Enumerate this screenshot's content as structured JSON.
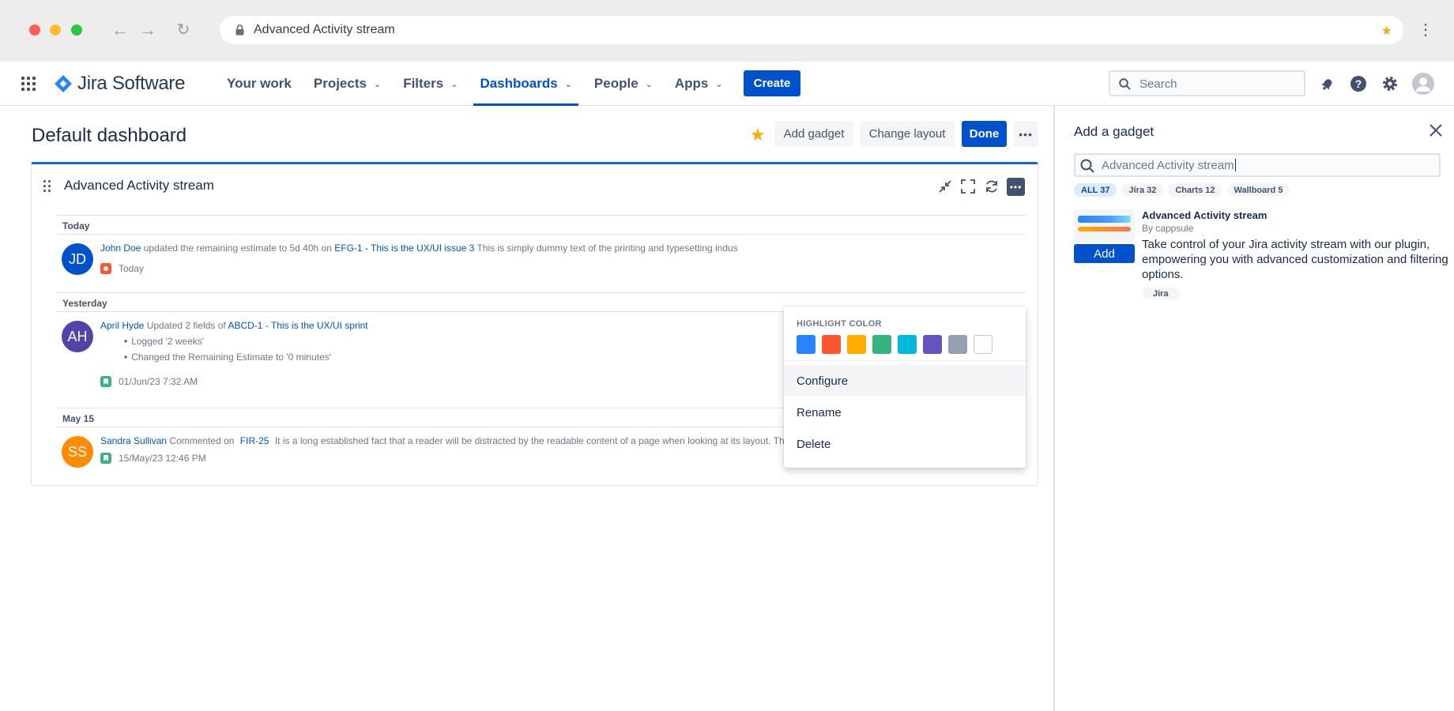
{
  "browser": {
    "url": "Advanced Activity stream"
  },
  "nav": {
    "product": "Jira Software",
    "items": [
      {
        "label": "Your work"
      },
      {
        "label": "Projects"
      },
      {
        "label": "Filters"
      },
      {
        "label": "Dashboards"
      },
      {
        "label": "People"
      },
      {
        "label": "Apps"
      }
    ],
    "active_item": "Dashboards",
    "create_label": "Create",
    "search_placeholder": "Search"
  },
  "dashboard": {
    "title": "Default dashboard",
    "add_gadget_label": "Add gadget",
    "change_layout_label": "Change layout",
    "done_label": "Done"
  },
  "gadget": {
    "title": "Advanced Activity stream",
    "more_label": "•••",
    "groups": [
      {
        "label": "Today",
        "entries": [
          {
            "initials": "JD",
            "avatar_color": "#0052cc",
            "user": "John Doe",
            "action": "updated the remaining estimate to 5d 40h on",
            "issue": "EFG-1 - This is the UX/UI issue 3",
            "extra": "This is simply dummy text of the printing and typesetting indus",
            "time": "Today"
          }
        ]
      },
      {
        "label": "Yesterday",
        "entries": [
          {
            "initials": "AH",
            "avatar_color": "#5243aa",
            "user": "April Hyde",
            "action": "Updated 2 fields of",
            "issue": "ABCD-1 - This is the UX/UI sprint",
            "bullets": [
              "Logged '2 weeks'",
              "Changed the Remaining Estimate to '0 minutes'"
            ],
            "time": "01/Jun/23 7:32 AM"
          }
        ]
      },
      {
        "label": "May 15",
        "entries": [
          {
            "initials": "SS",
            "avatar_color": "#ff8b00",
            "user": "Sandra Sullivan",
            "action": "Commented on",
            "issue": "FIR-25",
            "extra": "It is a long established fact that a reader will be distracted by the readable content of a page when looking at its layout. The point of using Lorem Ipsum is that",
            "time": "15/May/23 12:46 PM"
          }
        ]
      }
    ]
  },
  "menu": {
    "heading": "HIGHLIGHT COLOR",
    "colors": [
      "#2684ff",
      "#ff5630",
      "#ffab00",
      "#36b37e",
      "#00b8d9",
      "#6554c0",
      "#97a0af",
      "#ffffff"
    ],
    "items": [
      {
        "label": "Configure"
      },
      {
        "label": "Rename"
      },
      {
        "label": "Delete"
      }
    ]
  },
  "panel": {
    "title": "Add a gadget",
    "search_value": "Advanced Activity stream",
    "chips": [
      {
        "label": "ALL 37"
      },
      {
        "label": "Jira 32"
      },
      {
        "label": "Charts 12"
      },
      {
        "label": "Wallboard 5"
      }
    ],
    "result": {
      "name": "Advanced Activity stream",
      "by": "By cappsule",
      "add_label": "Add",
      "description": "Take control of your Jira activity stream with our plugin, empowering you with advanced customization and filtering options.",
      "tag": "Jira"
    }
  }
}
